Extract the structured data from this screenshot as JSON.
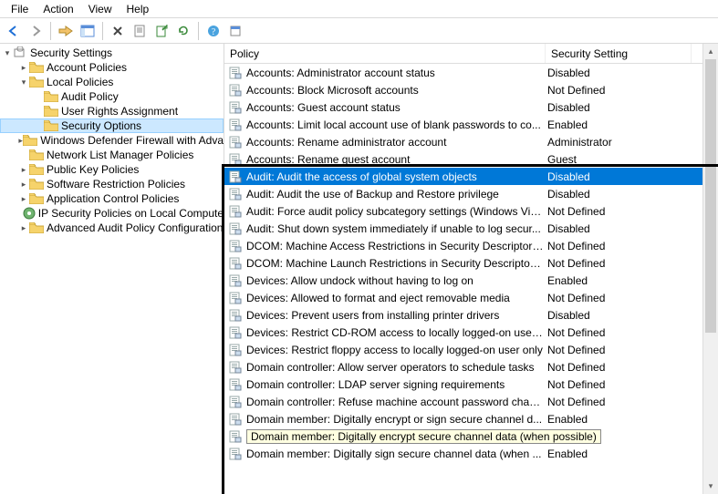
{
  "menu": {
    "file": "File",
    "action": "Action",
    "view": "View",
    "help": "Help"
  },
  "tree": {
    "root": "Security Settings",
    "items": [
      {
        "label": "Account Policies",
        "depth": 1,
        "exp": "closed"
      },
      {
        "label": "Local Policies",
        "depth": 1,
        "exp": "open"
      },
      {
        "label": "Audit Policy",
        "depth": 2,
        "exp": "none"
      },
      {
        "label": "User Rights Assignment",
        "depth": 2,
        "exp": "none"
      },
      {
        "label": "Security Options",
        "depth": 2,
        "exp": "none",
        "selected": true
      },
      {
        "label": "Windows Defender Firewall with Adva",
        "depth": 1,
        "exp": "closed"
      },
      {
        "label": "Network List Manager Policies",
        "depth": 1,
        "exp": "none"
      },
      {
        "label": "Public Key Policies",
        "depth": 1,
        "exp": "closed"
      },
      {
        "label": "Software Restriction Policies",
        "depth": 1,
        "exp": "closed"
      },
      {
        "label": "Application Control Policies",
        "depth": 1,
        "exp": "closed"
      },
      {
        "label": "IP Security Policies on Local Compute",
        "depth": 1,
        "exp": "none",
        "icon": "ipsec"
      },
      {
        "label": "Advanced Audit Policy Configuration",
        "depth": 1,
        "exp": "closed"
      }
    ]
  },
  "list": {
    "headers": {
      "policy": "Policy",
      "setting": "Security Setting"
    },
    "rows": [
      {
        "policy": "Accounts: Administrator account status",
        "setting": "Disabled"
      },
      {
        "policy": "Accounts: Block Microsoft accounts",
        "setting": "Not Defined"
      },
      {
        "policy": "Accounts: Guest account status",
        "setting": "Disabled"
      },
      {
        "policy": "Accounts: Limit local account use of blank passwords to co...",
        "setting": "Enabled"
      },
      {
        "policy": "Accounts: Rename administrator account",
        "setting": "Administrator"
      },
      {
        "policy": "Accounts: Rename guest account",
        "setting": "Guest"
      },
      {
        "policy": "Audit: Audit the access of global system objects",
        "setting": "Disabled",
        "selected": true
      },
      {
        "policy": "Audit: Audit the use of Backup and Restore privilege",
        "setting": "Disabled"
      },
      {
        "policy": "Audit: Force audit policy subcategory settings (Windows Vis...",
        "setting": "Not Defined"
      },
      {
        "policy": "Audit: Shut down system immediately if unable to log secur...",
        "setting": "Disabled"
      },
      {
        "policy": "DCOM: Machine Access Restrictions in Security Descriptor D...",
        "setting": "Not Defined"
      },
      {
        "policy": "DCOM: Machine Launch Restrictions in Security Descriptor D...",
        "setting": "Not Defined"
      },
      {
        "policy": "Devices: Allow undock without having to log on",
        "setting": "Enabled"
      },
      {
        "policy": "Devices: Allowed to format and eject removable media",
        "setting": "Not Defined"
      },
      {
        "policy": "Devices: Prevent users from installing printer drivers",
        "setting": "Disabled"
      },
      {
        "policy": "Devices: Restrict CD-ROM access to locally logged-on user ...",
        "setting": "Not Defined"
      },
      {
        "policy": "Devices: Restrict floppy access to locally logged-on user only",
        "setting": "Not Defined"
      },
      {
        "policy": "Domain controller: Allow server operators to schedule tasks",
        "setting": "Not Defined"
      },
      {
        "policy": "Domain controller: LDAP server signing requirements",
        "setting": "Not Defined"
      },
      {
        "policy": "Domain controller: Refuse machine account password chan...",
        "setting": "Not Defined"
      },
      {
        "policy": "Domain member: Digitally encrypt or sign secure channel d...",
        "setting": "Enabled"
      },
      {
        "policy": "Domain member: Digitally encrypt secure channel data (when possible)",
        "setting": "",
        "tooltip": true
      },
      {
        "policy": "Domain member: Digitally sign secure channel data (when ...",
        "setting": "Enabled"
      }
    ]
  }
}
